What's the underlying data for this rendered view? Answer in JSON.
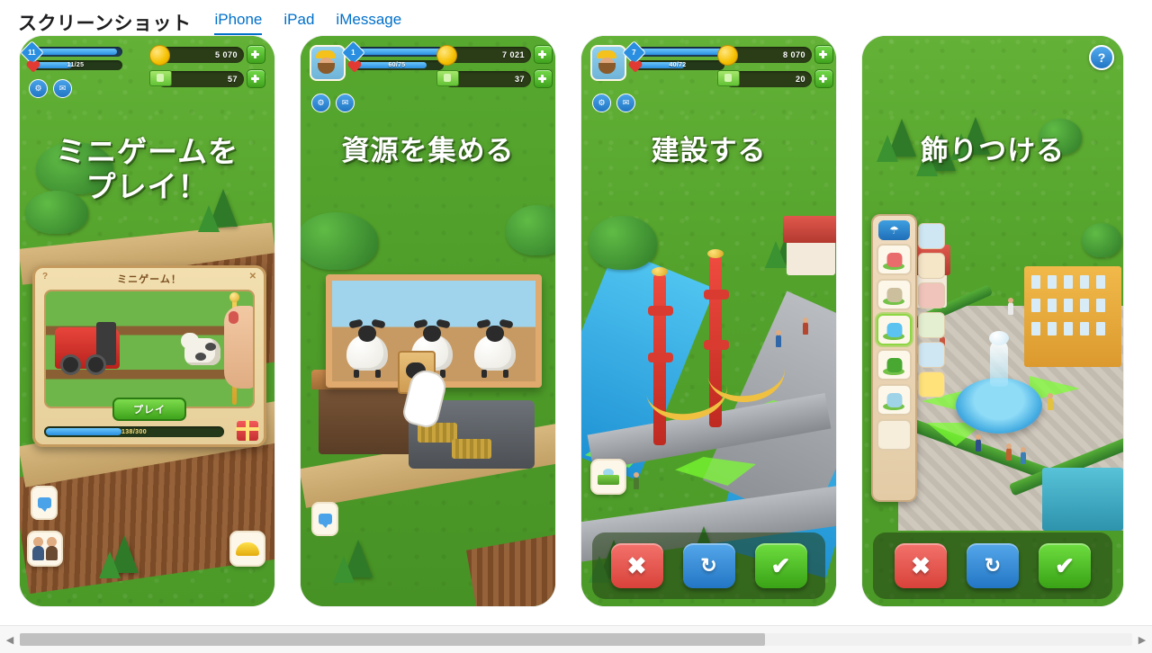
{
  "header": {
    "title": "スクリーンショット",
    "tabs": [
      {
        "label": "iPhone",
        "active": true
      },
      {
        "label": "iPad",
        "active": false
      },
      {
        "label": "iMessage",
        "active": false
      }
    ]
  },
  "colors": {
    "link": "#0070c9",
    "accent_green": "#4fa828",
    "coin_gold": "#f5c000",
    "cash_green": "#62c234",
    "cancel_red": "#d8423a",
    "rotate_blue": "#2376c4",
    "confirm_green": "#39a216"
  },
  "screenshots": [
    {
      "id": "minigame",
      "caption_lines": [
        "ミニゲームを",
        "プレイ！"
      ],
      "hud": {
        "level": "11",
        "xp_percent": 92,
        "energy": "11/25",
        "energy_percent": 44,
        "coins": "5 070",
        "cash": "57",
        "has_avatar": false,
        "settings_icon": "gear-icon",
        "mail_icon": "mail-icon"
      },
      "dialog": {
        "title": "ミニゲーム！",
        "help_label": "?",
        "close_label": "✕",
        "play_label": "プレイ",
        "progress_text": "138/300",
        "progress_percent": 42
      },
      "bottom_icons": [
        "chat-icon",
        "friends-icon",
        "hardhat-icon"
      ]
    },
    {
      "id": "gather",
      "caption_lines": [
        "資源を集める"
      ],
      "hud": {
        "level": "1",
        "xp_percent": 96,
        "energy": "60/75",
        "energy_percent": 80,
        "coins": "7 021",
        "cash": "37",
        "has_avatar": true,
        "settings_icon": "gear-icon",
        "mail_icon": "mail-icon"
      },
      "scene": {
        "animals": 3,
        "tap_hint": true
      },
      "bottom_icons": [
        "chat-icon"
      ]
    },
    {
      "id": "build",
      "caption_lines": [
        "建設する"
      ],
      "hud": {
        "level": "7",
        "xp_percent": 96,
        "energy": "40/72",
        "energy_percent": 56,
        "coins": "8 070",
        "cash": "20",
        "has_avatar": true,
        "settings_icon": "gear-icon",
        "mail_icon": "mail-icon"
      },
      "actions": [
        {
          "name": "cancel",
          "glyph": "✖"
        },
        {
          "name": "rotate",
          "glyph": "↻"
        },
        {
          "name": "confirm",
          "glyph": "✔"
        }
      ],
      "bottom_icons": [
        "terrain-icon"
      ]
    },
    {
      "id": "decorate",
      "caption_lines": [
        "飾りつける"
      ],
      "help_label": "?",
      "palette": {
        "header_icon": "decoration-menu-icon",
        "items": [
          {
            "name": "flower-bed",
            "color": "#e86c6c",
            "selected": false
          },
          {
            "name": "statue",
            "color": "#cbbf9e",
            "selected": false
          },
          {
            "name": "fountain",
            "color": "#5cc3f0",
            "selected": true
          },
          {
            "name": "topiary",
            "color": "#49a832",
            "selected": false
          },
          {
            "name": "rock-garden",
            "color": "#9fd3e8",
            "selected": false
          },
          {
            "name": "empty-slot",
            "color": "#f6edda",
            "selected": false
          }
        ]
      },
      "side_tools": [
        {
          "name": "house-blue"
        },
        {
          "name": "house-cream"
        },
        {
          "name": "house-red"
        },
        {
          "name": "eye-view"
        },
        {
          "name": "pond"
        },
        {
          "name": "star"
        }
      ],
      "actions": [
        {
          "name": "cancel",
          "glyph": "✖"
        },
        {
          "name": "rotate",
          "glyph": "↻"
        },
        {
          "name": "confirm",
          "glyph": "✔"
        }
      ]
    }
  ],
  "scrollbar": {
    "left_arrow": "◀",
    "right_arrow": "▶",
    "thumb_percent": 67
  }
}
